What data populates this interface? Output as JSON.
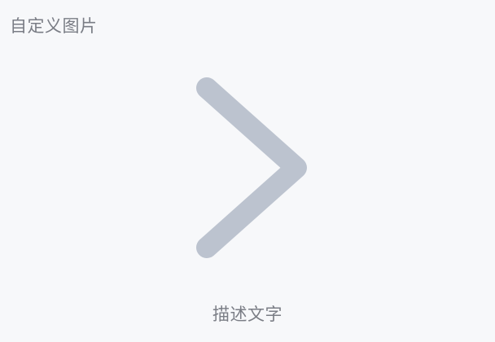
{
  "section": {
    "title": "自定义图片"
  },
  "image": {
    "icon": "chevron-right-icon",
    "color": "#bcc3cf"
  },
  "caption": {
    "text": "描述文字"
  },
  "colors": {
    "background": "#f7f8fa",
    "text": "#7a7d85",
    "icon": "#bcc3cf"
  }
}
